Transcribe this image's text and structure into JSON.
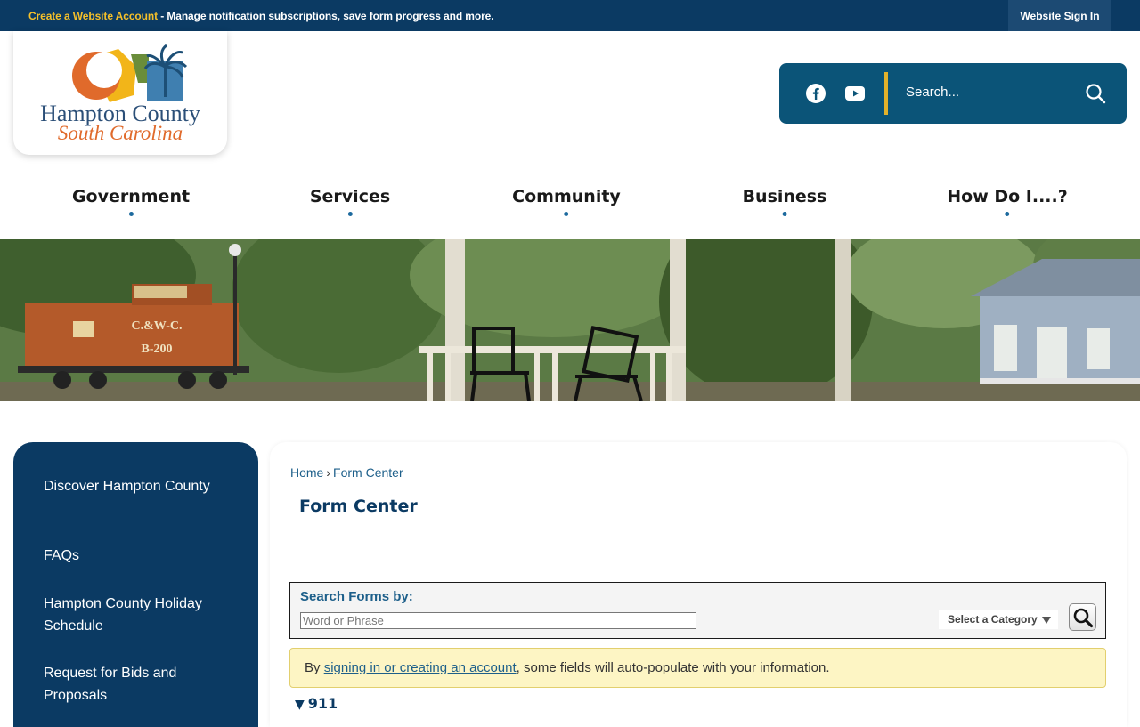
{
  "topbar": {
    "create_account": "Create a Website Account",
    "message": " - Manage notification subscriptions, save form progress and more.",
    "signin": "Website Sign In"
  },
  "logo": {
    "line1": "Hampton County",
    "line2": "South Carolina"
  },
  "header": {
    "search_placeholder": "Search...",
    "social": [
      "facebook-icon",
      "youtube-icon"
    ]
  },
  "nav": {
    "items": [
      "Government",
      "Services",
      "Community",
      "Business",
      "How Do I....?"
    ]
  },
  "banner": {
    "caboose_line1": "C.&W-C.",
    "caboose_line2": "B-200"
  },
  "sidebar": {
    "items": [
      "Discover Hampton County",
      "FAQs",
      "Hampton County Holiday Schedule",
      "Request for Bids and Proposals"
    ]
  },
  "content": {
    "breadcrumb_home": "Home",
    "breadcrumb_sep": "›",
    "breadcrumb_current": "Form Center",
    "title": "Form Center",
    "search_label": "Search Forms by:",
    "search_placeholder": "Word or Phrase",
    "category_select": "Select a Category",
    "notice_prefix": "By ",
    "notice_link": "signing in or creating an account",
    "notice_suffix": ", some fields will auto-populate with your information.",
    "section_toggle": "▼",
    "section_title": "911"
  },
  "colors": {
    "navy": "#0b3a63",
    "teal": "#0b5478",
    "gold": "#f5c02a",
    "link": "#1d5f8a",
    "notice_bg": "#fdf5c4"
  }
}
